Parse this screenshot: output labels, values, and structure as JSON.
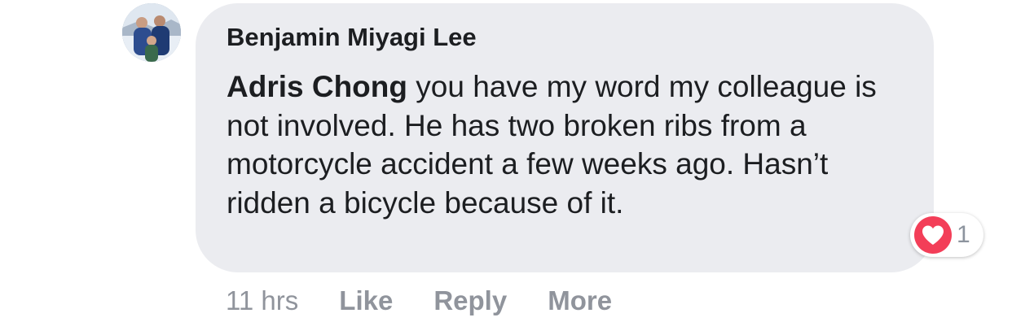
{
  "comment": {
    "author": "Benjamin Miyagi Lee",
    "mention": "Adris Chong",
    "body": " you have my word my colleague is not involved. He has two broken ribs from a motorcycle accident a few weeks ago. Hasn’t ridden a bicycle because of it.",
    "timestamp": "11 hrs",
    "reaction": {
      "icon": "heart-icon",
      "count": "1",
      "color": "#f33e58"
    }
  },
  "actions": {
    "like": "Like",
    "reply": "Reply",
    "more": "More"
  }
}
